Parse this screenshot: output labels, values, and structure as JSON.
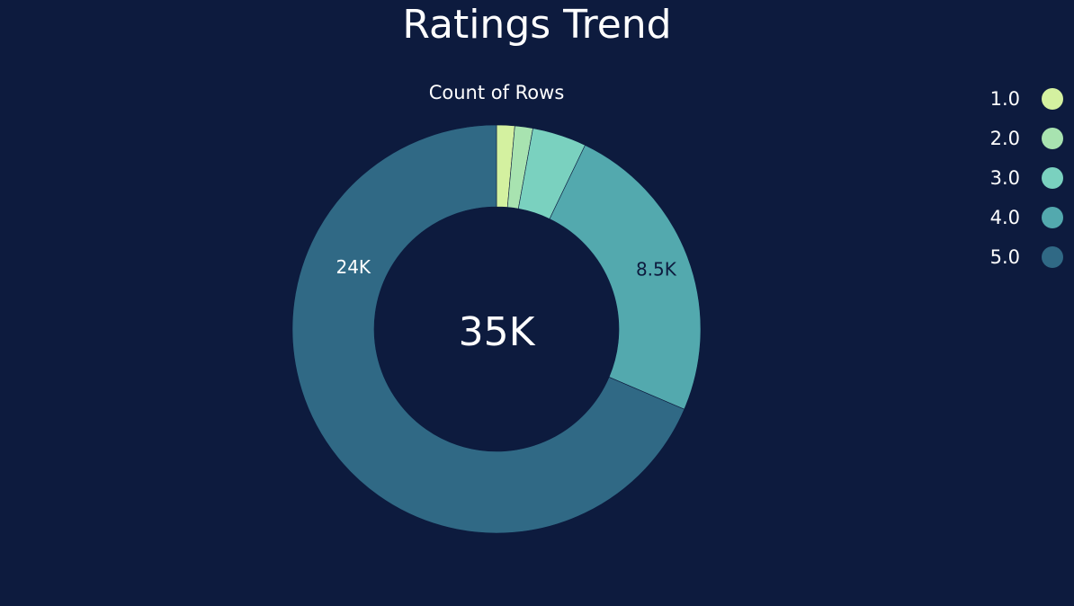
{
  "chart_data": {
    "type": "pie",
    "variant": "donut",
    "title": "Ratings Trend",
    "measure_label": "Count of Rows",
    "center_label": "35K",
    "categories": [
      "1.0",
      "2.0",
      "3.0",
      "4.0",
      "5.0"
    ],
    "values": [
      500,
      500,
      1500,
      8500,
      24000
    ],
    "data_labels": [
      "",
      "",
      "",
      "8.5K",
      "24K"
    ],
    "colors": [
      "#d4f1a0",
      "#a8e3b0",
      "#7ad1bf",
      "#53a9ae",
      "#306985"
    ],
    "label_colors": [
      "#0d1b3e",
      "#0d1b3e",
      "#0d1b3e",
      "#0d1b3e",
      "#ffffff"
    ],
    "legend_position": "right-top"
  }
}
